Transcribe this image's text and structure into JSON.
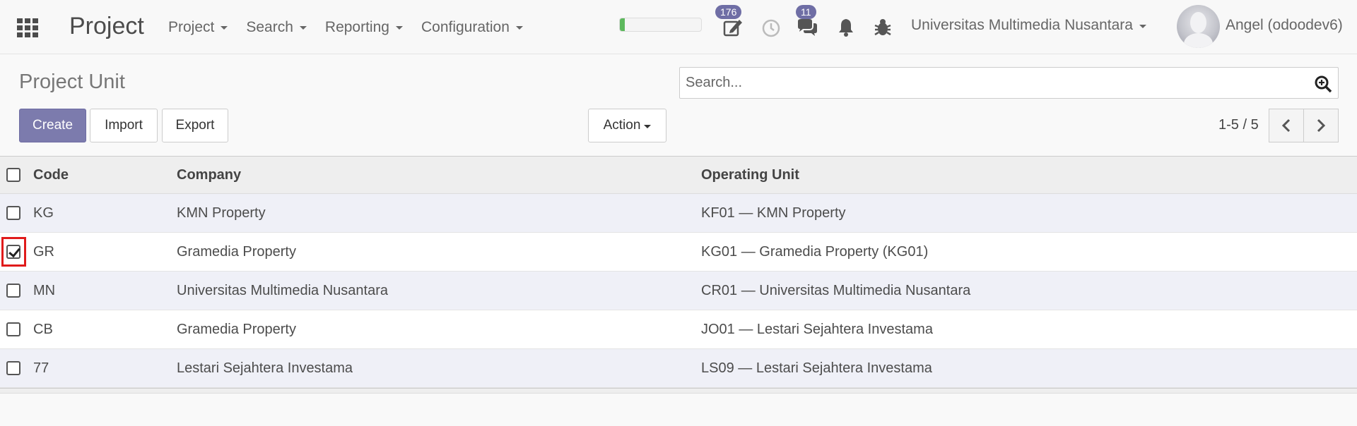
{
  "navbar": {
    "brand": "Project",
    "menu": [
      {
        "label": "Project"
      },
      {
        "label": "Search"
      },
      {
        "label": "Reporting"
      },
      {
        "label": "Configuration"
      }
    ],
    "progress_fraction": 0.06,
    "activity_badge": "176",
    "messages_badge": "11",
    "company": "Universitas Multimedia Nusantara",
    "user": "Angel (odoodev6)",
    "colors": {
      "accent": "#7c7bad",
      "badge": "#6f6ea5",
      "progress": "#5cb85c"
    }
  },
  "control_panel": {
    "title": "Project Unit",
    "search_placeholder": "Search...",
    "create_label": "Create",
    "import_label": "Import",
    "export_label": "Export",
    "action_label": "Action",
    "pager": "1-5 / 5"
  },
  "table": {
    "columns": [
      "Code",
      "Company",
      "Operating Unit"
    ],
    "rows": [
      {
        "code": "KG",
        "company": "KMN Property",
        "unit": "KF01 — KMN Property",
        "checked": false
      },
      {
        "code": "GR",
        "company": "Gramedia Property",
        "unit": "KG01 — Gramedia Property (KG01)",
        "checked": true
      },
      {
        "code": "MN",
        "company": "Universitas Multimedia Nusantara",
        "unit": "CR01 — Universitas Multimedia Nusantara",
        "checked": false
      },
      {
        "code": "CB",
        "company": "Gramedia Property",
        "unit": "JO01 — Lestari Sejahtera Investama",
        "checked": false
      },
      {
        "code": "77",
        "company": "Lestari Sejahtera Investama",
        "unit": "LS09 — Lestari Sejahtera Investama",
        "checked": false
      }
    ]
  }
}
